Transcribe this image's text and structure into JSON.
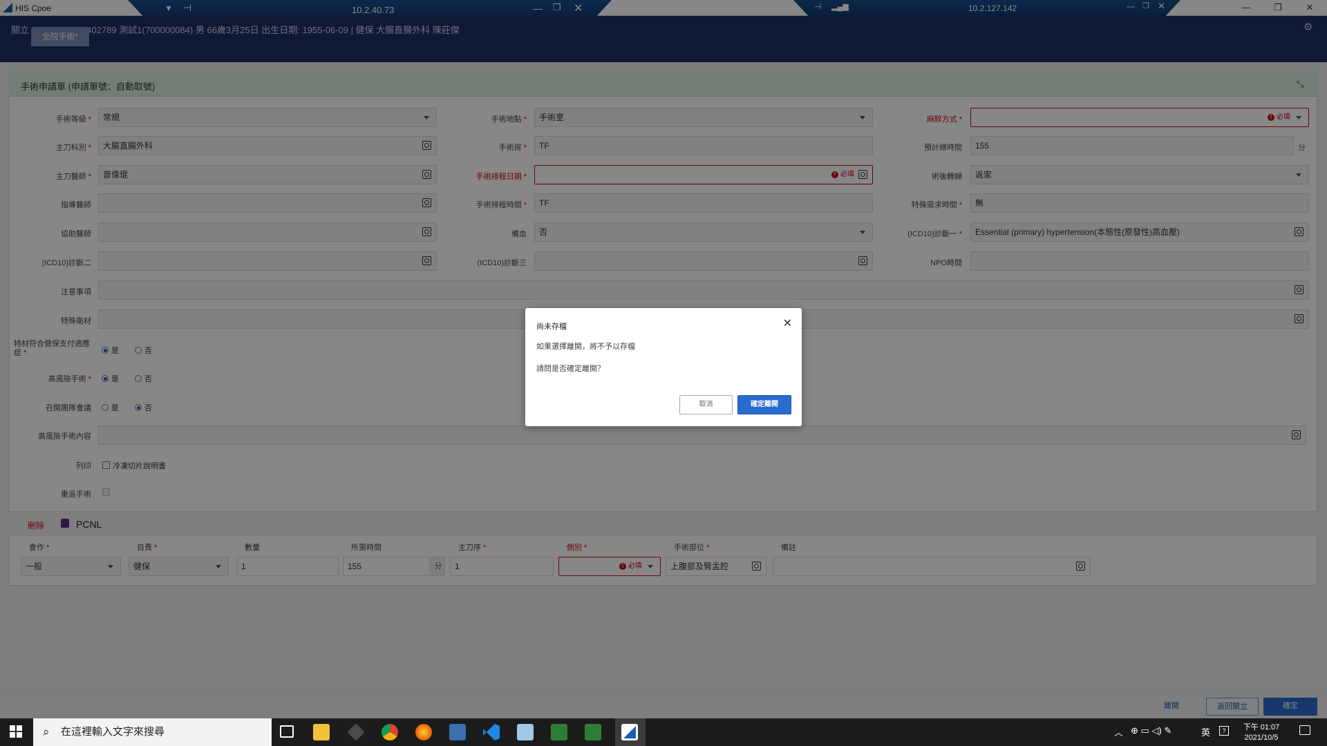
{
  "window": {
    "title": "HIS Cpoe",
    "rdp1": "10.2.40.73",
    "rdp2": "10.2.127.142"
  },
  "patient": {
    "back": "關立",
    "info": "O21100402789  測試1(700000084)  男  66歲3月25日  出生日期: 1955-06-09  |  健保  大腸直腸外科  陳莊傑"
  },
  "tab": {
    "label": "全院手術*"
  },
  "panel": {
    "title": "手術申請單 (申請單號：自動取號)"
  },
  "form": {
    "col1": [
      {
        "label": "手術等級",
        "required": true,
        "value": "常規",
        "kind": "select"
      },
      {
        "label": "主刀科別",
        "required": true,
        "value": "大腸直腸外科",
        "kind": "search"
      },
      {
        "label": "主刀醫師",
        "required": true,
        "value": "曾偉琨",
        "kind": "search"
      },
      {
        "label": "指導醫師",
        "required": false,
        "value": "",
        "kind": "search"
      },
      {
        "label": "協助醫師",
        "required": false,
        "value": "",
        "kind": "search"
      },
      {
        "label": "(ICD10)診斷二",
        "required": false,
        "value": "",
        "kind": "search"
      }
    ],
    "col2": [
      {
        "label": "手術地點",
        "required": true,
        "value": "手術室",
        "kind": "select"
      },
      {
        "label": "手術房",
        "required": true,
        "value": "TF",
        "kind": "text"
      },
      {
        "label": "手術排程日期",
        "required": true,
        "value": "",
        "kind": "search",
        "error": true
      },
      {
        "label": "手術排程時間",
        "required": true,
        "value": "TF",
        "kind": "text"
      },
      {
        "label": "備血",
        "required": false,
        "value": "否",
        "kind": "select"
      },
      {
        "label": "(ICD10)診斷三",
        "required": false,
        "value": "",
        "kind": "search"
      }
    ],
    "col3": [
      {
        "label": "麻醉方式",
        "required": true,
        "value": "",
        "kind": "select",
        "error": true
      },
      {
        "label": "預計總時間",
        "required": false,
        "value": "155",
        "kind": "text",
        "unit": "分"
      },
      {
        "label": "術後轉歸",
        "required": false,
        "value": "返家",
        "kind": "select"
      },
      {
        "label": "特殊需求時間",
        "required": true,
        "value": "無",
        "kind": "text"
      },
      {
        "label": "(ICD10)診斷一",
        "required": true,
        "value": "Essential (primary) hypertension(本態性(原發性)高血壓)",
        "kind": "search"
      },
      {
        "label": "NPO時間",
        "required": false,
        "value": "",
        "kind": "text"
      }
    ],
    "required_hint": "必填",
    "notes_label": "注意事項",
    "special_material_label": "特殊衛材",
    "material_cover": {
      "label": "特材符合健保支付適應症",
      "yes": "是",
      "no": "否"
    },
    "high_risk": {
      "label": "高風險手術",
      "yes": "是",
      "no": "否"
    },
    "risk_meeting": {
      "label": "召開團隊會議",
      "yes": "是",
      "no": "否"
    },
    "high_risk_content_label": "高風險手術內容",
    "print_label": "列印",
    "print_option": "冷凍切片說明書",
    "repeat_label": "重返手術"
  },
  "procedure": {
    "delete": "刪除",
    "name": "PCNL",
    "headers": [
      "會作",
      "自費",
      "數量",
      "所需時間",
      "主刀序",
      "側別",
      "手術部位",
      "備註"
    ],
    "values": [
      "一般",
      "健保",
      "1",
      "155",
      "1",
      "",
      "上腹部及腎盂腔",
      ""
    ],
    "unit": "分"
  },
  "footer": {
    "leave": "離開",
    "back": "返回關立",
    "confirm": "確定"
  },
  "dialog": {
    "title": "尚未存檔",
    "line1": "如果選擇離開，將不予以存檔",
    "line2": "請問是否確定離開？",
    "cancel": "取消",
    "ok": "確定離開"
  },
  "taskbar": {
    "search_placeholder": "在這裡輸入文字來搜尋",
    "time": "下午 01:07",
    "date": "2021/10/5",
    "ime": "英"
  }
}
